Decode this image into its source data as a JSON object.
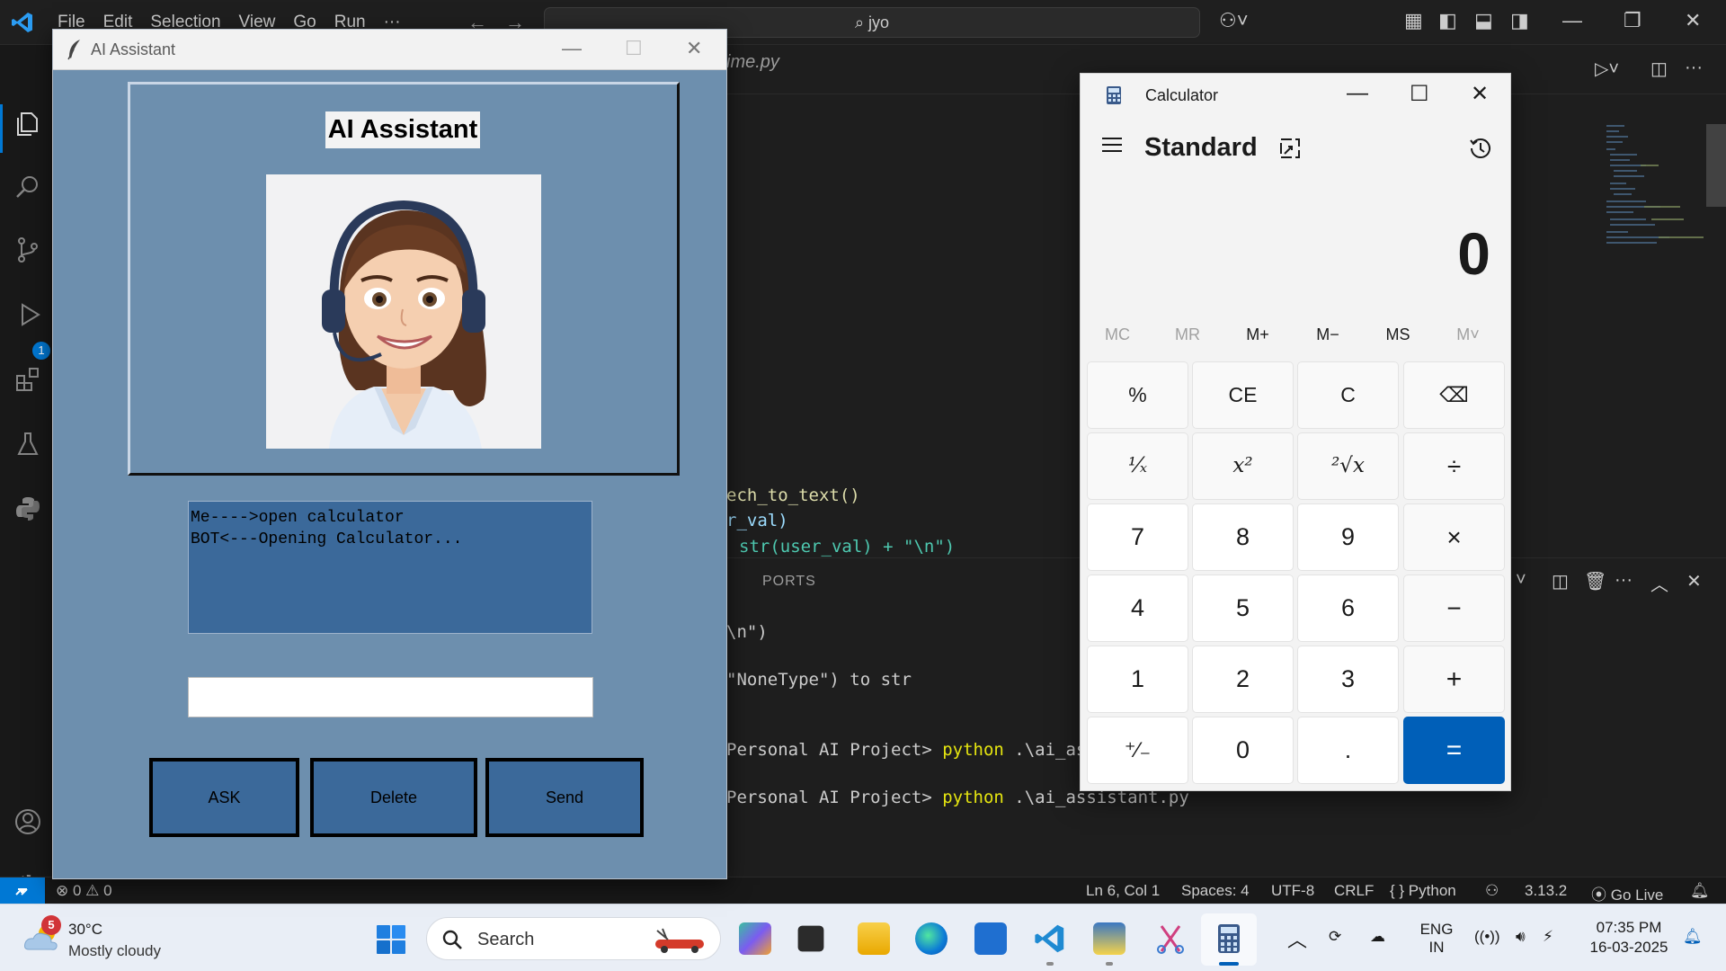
{
  "vscode": {
    "menu": [
      "File",
      "Edit",
      "Selection",
      "View",
      "Go",
      "Run",
      "···"
    ],
    "search_text": "jyo",
    "tab_name": "ime.py",
    "code_lines": [
      "ech_to_text()",
      "r_val)",
      "str(user_val) + \"\\n\")"
    ],
    "panel_tab": "PORTS",
    "terminal": {
      "line1": "\\n\")",
      "line2": "\"NoneType\") to str",
      "prompt1": "Personal AI Project> ",
      "cmd1": "python",
      "arg1": " .\\ai_ass",
      "prompt2": "Personal AI Project> ",
      "cmd2": "python",
      "arg2": " .\\ai_assistant.py"
    },
    "activity_badge": "1",
    "statusbar": {
      "problems": "⊗ 0 ⚠ 0",
      "position": "Ln 6, Col 1",
      "spaces": "Spaces: 4",
      "encoding": "UTF-8",
      "eol": "CRLF",
      "language": "{ } Python",
      "version": "3.13.2",
      "golive": "Go Live"
    }
  },
  "ai_window": {
    "title": "AI Assistant",
    "heading": "AI Assistant",
    "chat": [
      "Me---->open calculator",
      "BOT<---Opening Calculator..."
    ],
    "input_value": "",
    "buttons": {
      "ask": "ASK",
      "delete": "Delete",
      "send": "Send"
    }
  },
  "calculator": {
    "title": "Calculator",
    "mode": "Standard",
    "display": "0",
    "memory": [
      "MC",
      "MR",
      "M+",
      "M−",
      "MS",
      "M˅"
    ],
    "keys": {
      "percent": "%",
      "ce": "CE",
      "c": "C",
      "backspace": "⌫",
      "reciprocal": "¹⁄ₓ",
      "square": "x²",
      "sqrt": "²√x",
      "divide": "÷",
      "k7": "7",
      "k8": "8",
      "k9": "9",
      "multiply": "×",
      "k4": "4",
      "k5": "5",
      "k6": "6",
      "minus": "−",
      "k1": "1",
      "k2": "2",
      "k3": "3",
      "plus": "+",
      "negate": "⁺⁄₋",
      "k0": "0",
      "decimal": ".",
      "equals": "="
    }
  },
  "taskbar": {
    "weather_badge": "5",
    "temperature": "30°C",
    "weather": "Mostly cloudy",
    "search_label": "Search",
    "language_top": "ENG",
    "language_bottom": "IN",
    "time": "07:35 PM",
    "date": "16-03-2025"
  },
  "colors": {
    "ai_bg": "#6d8fae",
    "ai_widget": "#3b699a",
    "calc_accent": "#005fb8",
    "vscode_blue": "#0078d4"
  }
}
